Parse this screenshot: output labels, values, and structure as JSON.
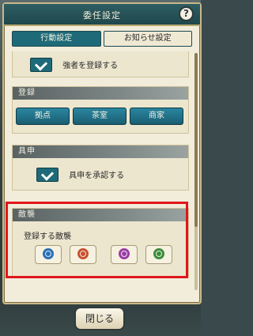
{
  "dialog": {
    "title": "委任設定",
    "help_glyph": "?"
  },
  "tabs": [
    {
      "label": "行動設定",
      "active": true
    },
    {
      "label": "お知らせ設定",
      "active": false
    }
  ],
  "sections": {
    "top_row": {
      "label": "強者を登録する",
      "checked": true
    },
    "register": {
      "title": "登録",
      "buttons": [
        "拠点",
        "茶室",
        "商家"
      ]
    },
    "request": {
      "title": "具申",
      "row_label": "具申を承認する",
      "checked": true
    },
    "raid": {
      "title": "敵襲",
      "subtitle": "登録する敵襲",
      "icons": [
        {
          "name": "blue-raid-icon",
          "color": "#2a6fb3"
        },
        {
          "name": "red-raid-icon",
          "color": "#c9522e"
        },
        {
          "name": "purple-raid-icon",
          "color": "#9a3da6"
        },
        {
          "name": "green-raid-icon",
          "color": "#3c8c3a"
        }
      ]
    }
  },
  "footer": {
    "close_label": "閉じる"
  }
}
